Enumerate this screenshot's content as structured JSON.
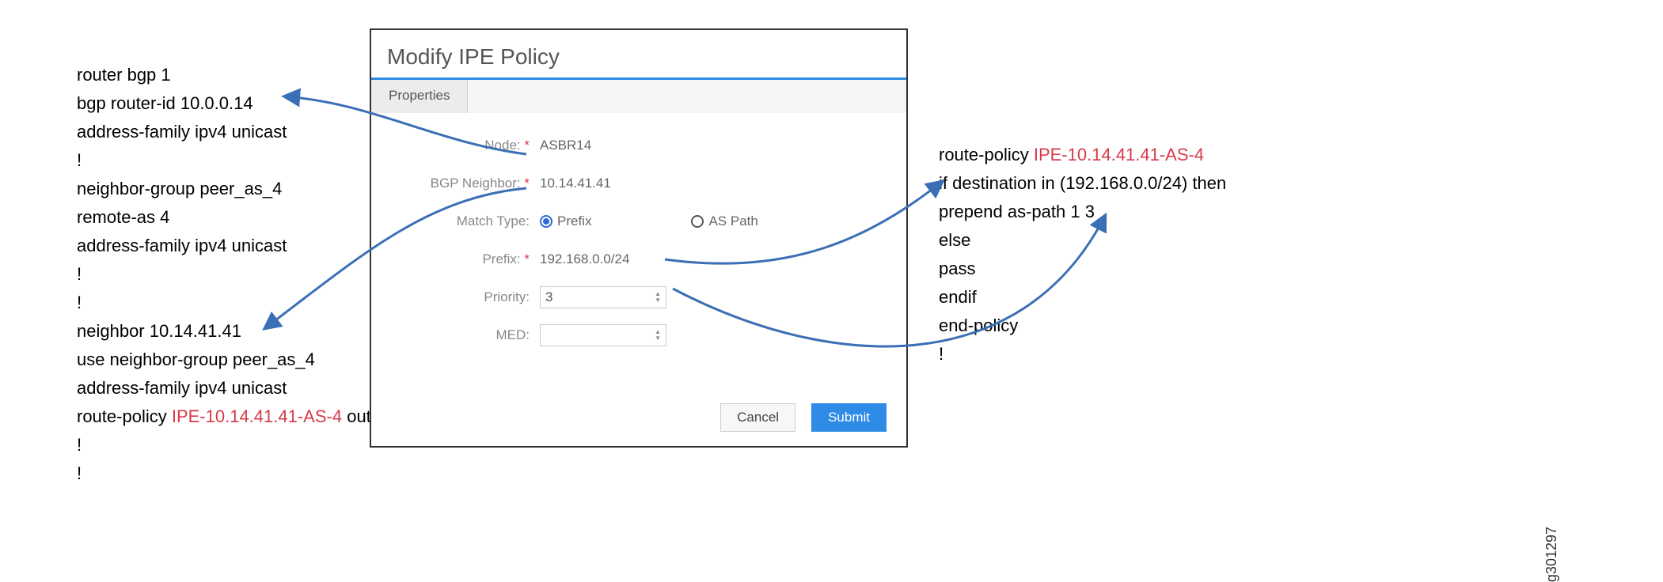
{
  "left_config": {
    "lines": [
      "router bgp 1",
      " bgp router-id 10.0.0.14",
      " address-family ipv4 unicast",
      " !",
      " neighbor-group peer_as_4",
      "  remote-as 4",
      "  address-family ipv4 unicast",
      "  !",
      " !",
      " neighbor 10.14.41.41",
      "  use neighbor-group peer_as_4",
      "  address-family ipv4 unicast",
      "   route-policy ",
      "  !",
      " !"
    ],
    "route_policy_highlight": "IPE-10.14.41.41-AS-4",
    "route_policy_suffix": " out"
  },
  "right_config": {
    "lines": [
      "route-policy ",
      " if destination in (192.168.0.0/24) then",
      "  prepend as-path 1 3",
      " else",
      "  pass",
      " endif",
      "end-policy",
      "!"
    ],
    "policy_name": "IPE-10.14.41.41-AS-4"
  },
  "dialog": {
    "title": "Modify IPE Policy",
    "tab": "Properties",
    "labels": {
      "node": "Node:",
      "bgp_neighbor": "BGP Neighbor:",
      "match_type": "Match Type:",
      "prefix": "Prefix:",
      "priority": "Priority:",
      "med": "MED:"
    },
    "values": {
      "node": "ASBR14",
      "bgp_neighbor": "10.14.41.41",
      "prefix_radio": "Prefix",
      "aspath_radio": "AS Path",
      "prefix": "192.168.0.0/24",
      "priority": "3",
      "med": ""
    },
    "buttons": {
      "cancel": "Cancel",
      "submit": "Submit"
    }
  },
  "figure_id": "g301297",
  "arrows": {
    "color": "#3b6fb5"
  }
}
